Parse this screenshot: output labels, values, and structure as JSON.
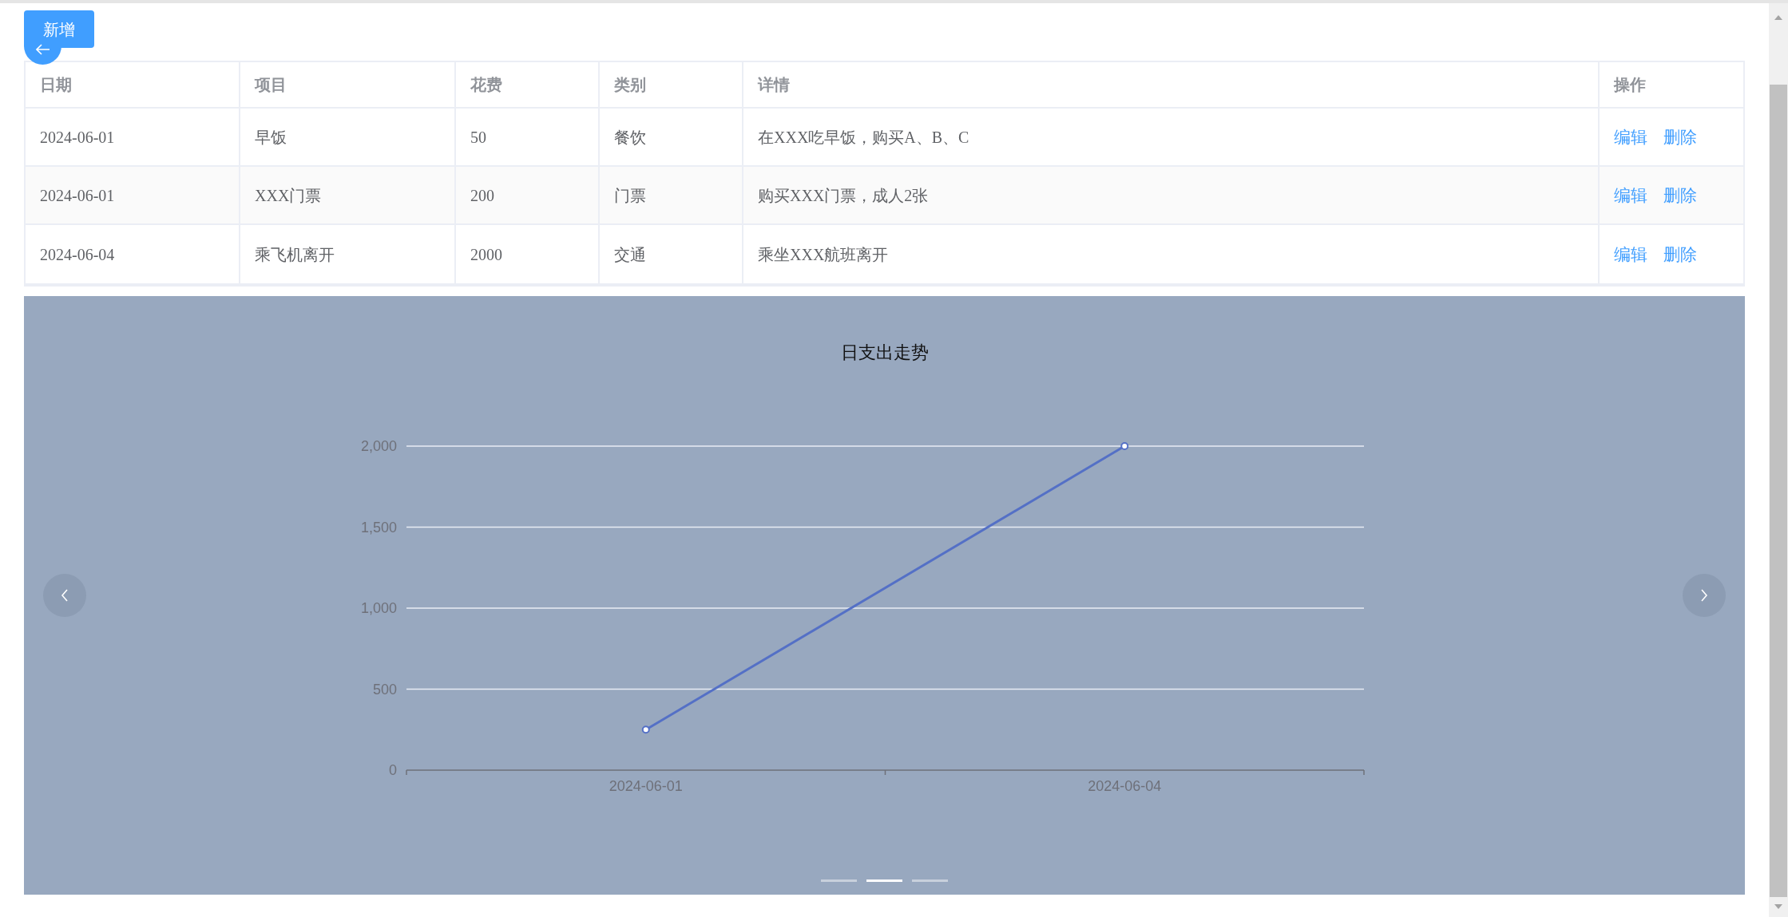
{
  "add_button": {
    "label": "新增"
  },
  "table": {
    "columns": [
      "日期",
      "项目",
      "花费",
      "类别",
      "详情",
      "操作"
    ],
    "rows": [
      {
        "cells": [
          "2024-06-01",
          "早饭",
          "50",
          "餐饮",
          "在XXX吃早饭，购买A、B、C"
        ],
        "actions": [
          "编辑",
          "删除"
        ]
      },
      {
        "cells": [
          "2024-06-01",
          "XXX门票",
          "200",
          "门票",
          "购买XXX门票，成人2张"
        ],
        "actions": [
          "编辑",
          "删除"
        ]
      },
      {
        "cells": [
          "2024-06-04",
          "乘飞机离开",
          "2000",
          "交通",
          "乘坐XXX航班离开"
        ],
        "actions": [
          "编辑",
          "删除"
        ]
      }
    ]
  },
  "carousel": {
    "indicators": [
      {
        "selected": false
      },
      {
        "selected": true
      },
      {
        "selected": false
      }
    ],
    "chart_data": {
      "type": "line",
      "title": "日支出走势",
      "categories": [
        "2024-06-01",
        "2024-06-04"
      ],
      "grid": true,
      "series": [
        {
          "color": "#5470c6",
          "marker": true,
          "values": [
            250,
            2000
          ]
        }
      ],
      "ylim": [
        0,
        2000
      ],
      "yticks": [
        {
          "value": 0,
          "label": "0"
        },
        {
          "value": 500,
          "label": "500"
        },
        {
          "value": 1000,
          "label": "1,000"
        },
        {
          "value": 1500,
          "label": "1,500"
        },
        {
          "value": 2000,
          "label": "2,000"
        }
      ]
    }
  }
}
